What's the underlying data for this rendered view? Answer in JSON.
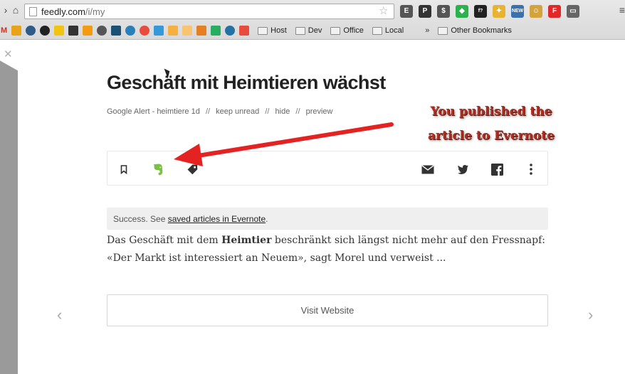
{
  "browser": {
    "url_host": "feedly.com",
    "url_path": "/i/my",
    "bookmarks_prefix": "M",
    "folders": [
      "Host",
      "Dev",
      "Office",
      "Local"
    ],
    "more": "»",
    "other_bookmarks": "Other Bookmarks",
    "extensions": [
      {
        "icon": "evernote-ext-icon",
        "color": "#555555",
        "glyph": "E"
      },
      {
        "icon": "pocket-ext-icon",
        "color": "#333333",
        "glyph": "P"
      },
      {
        "icon": "mic-ext-icon",
        "color": "#555555",
        "glyph": "$"
      },
      {
        "icon": "feedly-ext-icon",
        "color": "#2bb24c",
        "glyph": "◆"
      },
      {
        "icon": "fx-ext-icon",
        "color": "#222222",
        "glyph": "f?"
      },
      {
        "icon": "puzzle-ext-icon",
        "color": "#e8b330",
        "glyph": "✦"
      },
      {
        "icon": "new-ext-icon",
        "color": "#3a6fb0",
        "glyph": "NEW"
      },
      {
        "icon": "face-ext-icon",
        "color": "#d4a33a",
        "glyph": "☺"
      },
      {
        "icon": "flipboard-ext-icon",
        "color": "#e12828",
        "glyph": "F"
      },
      {
        "icon": "cast-ext-icon",
        "color": "#666666",
        "glyph": "▭"
      }
    ]
  },
  "article": {
    "title": "Geschäft mit Heimtieren wächst",
    "meta": {
      "source": "Google Alert - heimtiere",
      "age": "1d",
      "sep": "//",
      "keep_unread": "keep unread",
      "hide": "hide",
      "preview": "preview"
    },
    "callout_line1": "You published the",
    "callout_line2": "article to Evernote",
    "success_prefix": "Success. See ",
    "success_link": "saved articles in Evernote",
    "success_suffix": ".",
    "body_before": "Das Geschäft mit dem ",
    "body_bold": "Heimtier",
    "body_after": " beschränkt sich längst nicht mehr auf den Fressnapf: «Der Markt ist interessiert an Neuem», sagt Morel und verweist ...",
    "visit_label": "Visit Website"
  },
  "colors": {
    "evernote": "#7ac142",
    "arrow": "#e52222",
    "callout": "#b22d1f"
  }
}
